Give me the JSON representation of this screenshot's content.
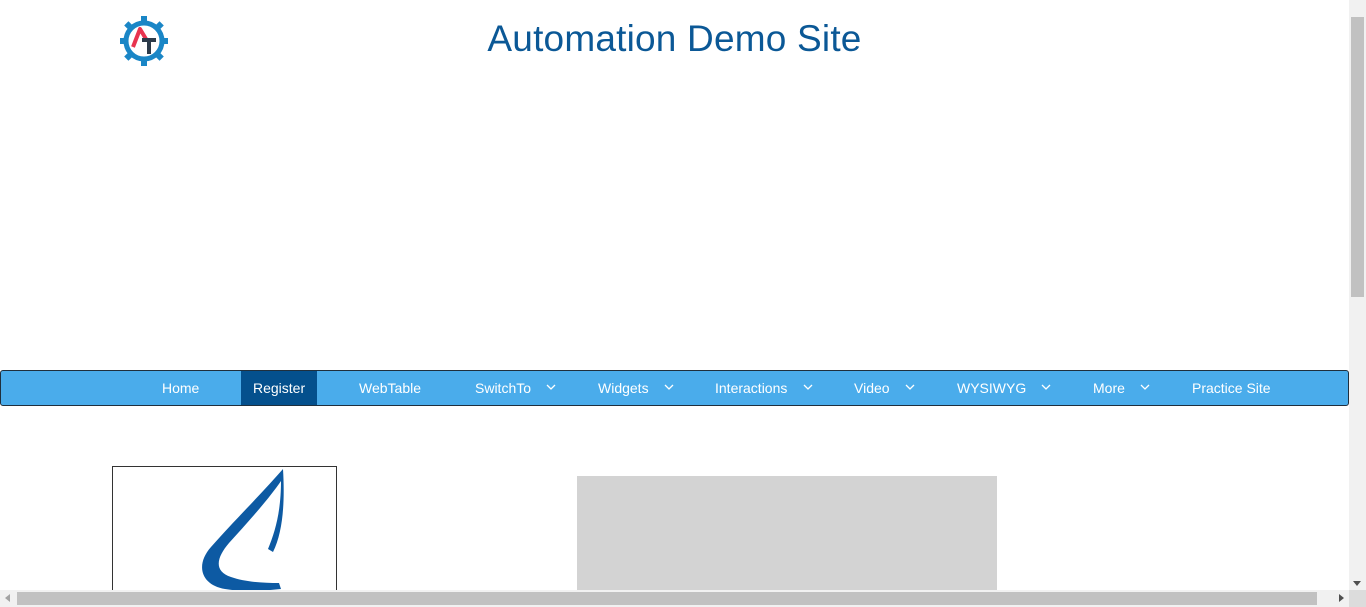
{
  "header": {
    "title": "Automation Demo Site",
    "logo_icon": "gear-logo-icon"
  },
  "nav": {
    "items": [
      {
        "label": "Home",
        "has_dropdown": false,
        "active": false
      },
      {
        "label": "Register",
        "has_dropdown": false,
        "active": true
      },
      {
        "label": "WebTable",
        "has_dropdown": false,
        "active": false
      },
      {
        "label": "SwitchTo",
        "has_dropdown": true,
        "active": false
      },
      {
        "label": "Widgets",
        "has_dropdown": true,
        "active": false
      },
      {
        "label": "Interactions",
        "has_dropdown": true,
        "active": false
      },
      {
        "label": "Video",
        "has_dropdown": true,
        "active": false
      },
      {
        "label": "WYSIWYG",
        "has_dropdown": true,
        "active": false
      },
      {
        "label": "More",
        "has_dropdown": true,
        "active": false
      },
      {
        "label": "Practice Site",
        "has_dropdown": false,
        "active": false
      }
    ]
  },
  "colors": {
    "title": "#0b5896",
    "nav_bg": "#4aaceb",
    "nav_active": "#04508d",
    "panel_gray": "#d3d3d3"
  }
}
